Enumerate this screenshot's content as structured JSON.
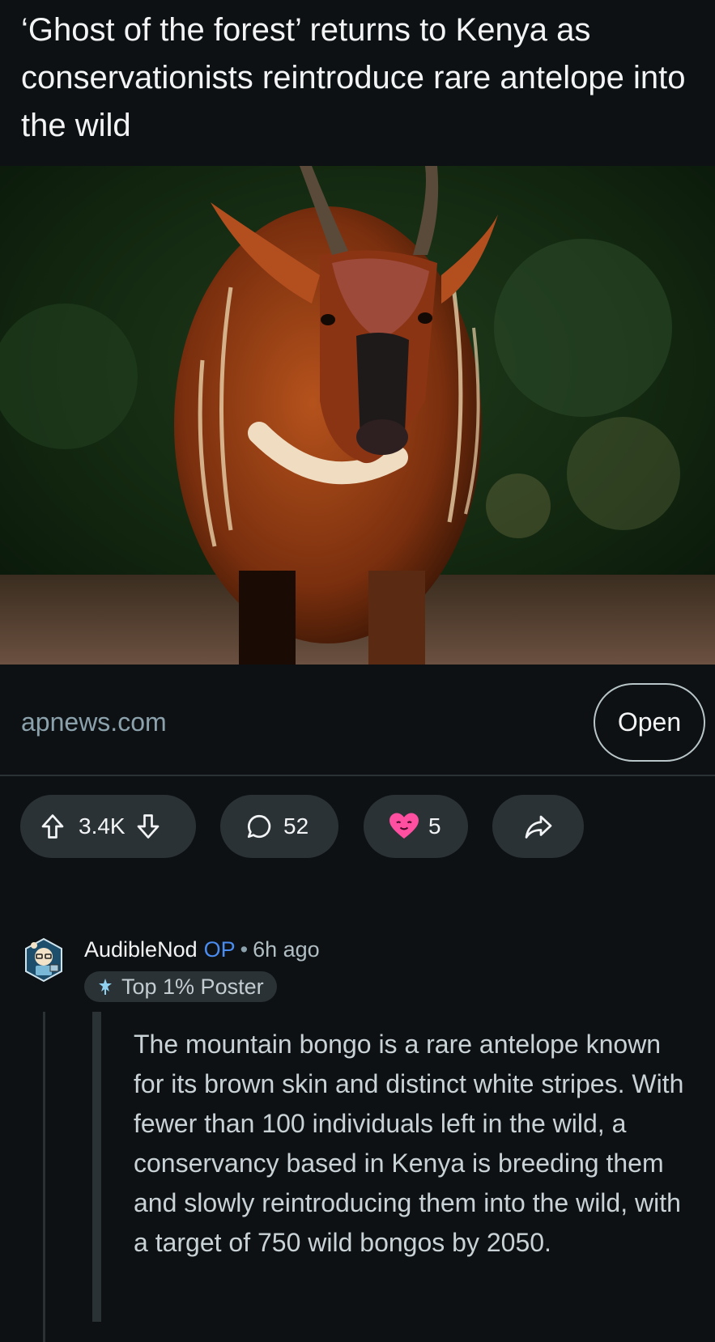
{
  "post": {
    "title": "‘Ghost of the forest’ returns to Kenya as conservationists reintroduce rare antelope into the wild",
    "link_domain": "apnews.com",
    "open_label": "Open"
  },
  "actions": {
    "score": "3.4K",
    "comments": "52",
    "awards": "5"
  },
  "comment": {
    "author": "AudibleNod",
    "op_badge": "OP",
    "separator": "•",
    "time": "6h ago",
    "flair": "Top 1% Poster",
    "text": "The mountain bongo is a rare antelope known for its brown skin and distinct white stripes. With fewer than 100 individuals left in the wild, a conservancy based in Kenya is breeding them and slowly reintroducing them into the wild, with a target of 750 wild bongos by 2050."
  },
  "colors": {
    "background": "#0e1113",
    "pill": "#2a3236",
    "op_blue": "#4a8cf0",
    "award_pink": "#ff4fa0"
  },
  "icons": [
    "upvote-icon",
    "downvote-icon",
    "comment-icon",
    "award-icon",
    "share-icon",
    "avatar-icon",
    "flair-icon"
  ]
}
